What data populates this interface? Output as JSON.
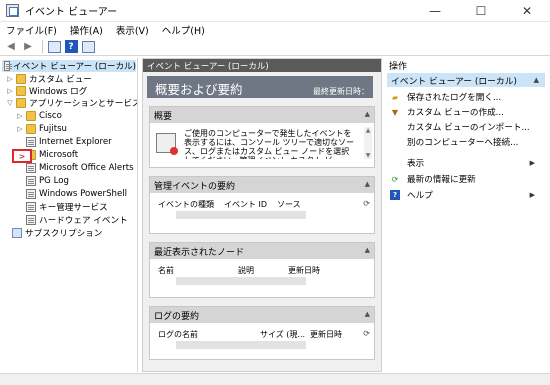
{
  "window": {
    "title": "イベント ビューアー",
    "min": "—",
    "max": "☐",
    "close": "✕"
  },
  "menu": [
    "ファイル(F)",
    "操作(A)",
    "表示(V)",
    "ヘルプ(H)"
  ],
  "toolbar": {
    "help": "?"
  },
  "tree": {
    "root": "イベント ビューアー (ローカル)",
    "items": [
      {
        "label": "カスタム ビュー"
      },
      {
        "label": "Windows ログ"
      },
      {
        "label": "アプリケーションとサービス ログ"
      },
      {
        "label": "Cisco"
      },
      {
        "label": "Fujitsu"
      },
      {
        "label": "Internet Explorer"
      },
      {
        "label": "Microsoft"
      },
      {
        "label": "Microsoft Office Alerts"
      },
      {
        "label": "PG Log"
      },
      {
        "label": "Windows PowerShell"
      },
      {
        "label": "キー管理サービス"
      },
      {
        "label": "ハードウェア イベント"
      },
      {
        "label": "サブスクリプション"
      }
    ]
  },
  "middle": {
    "header": "イベント ビューアー (ローカル)",
    "banner_title": "概要および要約",
    "banner_right": "最終更新日時：",
    "overview": {
      "title": "概要",
      "text": "ご使用のコンピューターで発生したイベントを表示するには、コンソール ツリーで適切なソース、ログまたはカスタム ビュー ノードを選択してください。管理イベント カスタム ビューには、ソースに関係なくすべ"
    },
    "admin": {
      "title": "管理イベントの要約",
      "cols": [
        "イベントの種類",
        "イベント ID",
        "ソース"
      ]
    },
    "recent": {
      "title": "最近表示されたノード",
      "cols": [
        "名前",
        "説明",
        "更新日時"
      ]
    },
    "logs": {
      "title": "ログの要約",
      "cols": [
        "ログの名前",
        "サイズ (現...",
        "更新日時"
      ]
    }
  },
  "actions": {
    "title": "操作",
    "selected": "イベント ビューアー (ローカル)",
    "items": [
      {
        "label": "保存されたログを開く..."
      },
      {
        "label": "カスタム ビューの作成..."
      },
      {
        "label": "カスタム ビューのインポート..."
      },
      {
        "label": "別のコンピューターへ接続..."
      },
      {
        "label": "表示"
      },
      {
        "label": "最新の情報に更新"
      },
      {
        "label": "ヘルプ"
      }
    ]
  }
}
